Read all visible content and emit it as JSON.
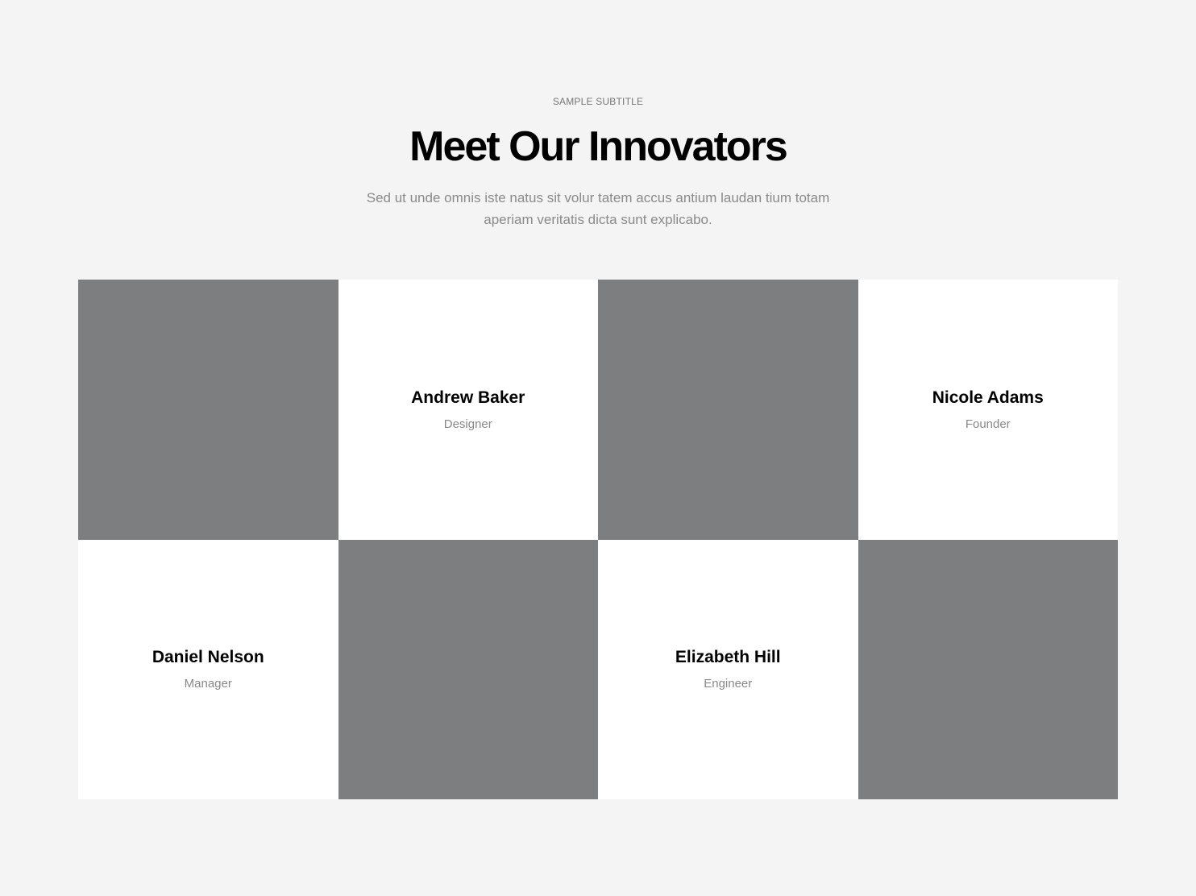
{
  "header": {
    "subtitle": "SAMPLE SUBTITLE",
    "title": "Meet Our Innovators",
    "description": "Sed ut unde omnis iste natus sit volur tatem accus antium laudan tium totam aperiam veritatis dicta sunt explicabo."
  },
  "team": [
    {
      "name": "Andrew Baker",
      "role": "Designer"
    },
    {
      "name": "Nicole Adams",
      "role": "Founder"
    },
    {
      "name": "Daniel Nelson",
      "role": "Manager"
    },
    {
      "name": "Elizabeth Hill",
      "role": "Engineer"
    }
  ]
}
